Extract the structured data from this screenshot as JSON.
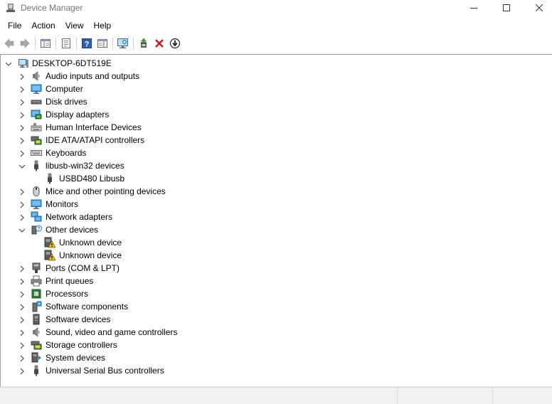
{
  "window": {
    "title": "Device Manager",
    "icon": "device-manager-icon",
    "controls": [
      "minimize-icon",
      "maximize-icon",
      "close-icon"
    ]
  },
  "menu": [
    "File",
    "Action",
    "View",
    "Help"
  ],
  "toolbar": [
    {
      "name": "back-button",
      "icon": "arrow-left-icon"
    },
    {
      "name": "forward-button",
      "icon": "arrow-right-icon"
    },
    {
      "name": "show-hide-console-tree-button",
      "icon": "console-tree-icon"
    },
    {
      "name": "properties-button",
      "icon": "properties-icon"
    },
    {
      "name": "help-button",
      "icon": "help-icon"
    },
    {
      "name": "show-action-pane-button",
      "icon": "action-pane-icon"
    },
    {
      "name": "scan-hardware-button",
      "icon": "monitor-scan-icon"
    },
    {
      "name": "update-driver-button",
      "icon": "update-driver-icon"
    },
    {
      "name": "uninstall-device-button",
      "icon": "red-x-icon"
    },
    {
      "name": "disable-device-button",
      "icon": "down-arrow-circle-icon"
    }
  ],
  "tree": {
    "root": {
      "label": "DESKTOP-6DT519E",
      "icon": "computer-icon",
      "expanded": true
    },
    "items": [
      {
        "label": "Audio inputs and outputs",
        "icon": "speaker-icon",
        "expanded": false,
        "children": []
      },
      {
        "label": "Computer",
        "icon": "monitor-icon",
        "expanded": false,
        "children": []
      },
      {
        "label": "Disk drives",
        "icon": "disk-drive-icon",
        "expanded": false,
        "children": []
      },
      {
        "label": "Display adapters",
        "icon": "display-adapter-icon",
        "expanded": false,
        "children": []
      },
      {
        "label": "Human Interface Devices",
        "icon": "hid-icon",
        "expanded": false,
        "children": []
      },
      {
        "label": "IDE ATA/ATAPI controllers",
        "icon": "ide-controller-icon",
        "expanded": false,
        "children": []
      },
      {
        "label": "Keyboards",
        "icon": "keyboard-icon",
        "expanded": false,
        "children": []
      },
      {
        "label": "libusb-win32 devices",
        "icon": "usb-plug-icon",
        "expanded": true,
        "children": [
          {
            "label": "USBD480 Libusb",
            "icon": "usb-plug-icon"
          }
        ]
      },
      {
        "label": "Mice and other pointing devices",
        "icon": "mouse-icon",
        "expanded": false,
        "children": []
      },
      {
        "label": "Monitors",
        "icon": "monitor-icon",
        "expanded": false,
        "children": []
      },
      {
        "label": "Network adapters",
        "icon": "network-adapter-icon",
        "expanded": false,
        "children": []
      },
      {
        "label": "Other devices",
        "icon": "unknown-device-icon",
        "expanded": true,
        "children": [
          {
            "label": "Unknown device",
            "icon": "warning-device-icon"
          },
          {
            "label": "Unknown device",
            "icon": "warning-device-icon"
          }
        ]
      },
      {
        "label": "Ports (COM & LPT)",
        "icon": "port-icon",
        "expanded": false,
        "children": []
      },
      {
        "label": "Print queues",
        "icon": "printer-icon",
        "expanded": false,
        "children": []
      },
      {
        "label": "Processors",
        "icon": "processor-icon",
        "expanded": false,
        "children": []
      },
      {
        "label": "Software components",
        "icon": "software-component-icon",
        "expanded": false,
        "children": []
      },
      {
        "label": "Software devices",
        "icon": "software-device-icon",
        "expanded": false,
        "children": []
      },
      {
        "label": "Sound, video and game controllers",
        "icon": "speaker-icon",
        "expanded": false,
        "children": []
      },
      {
        "label": "Storage controllers",
        "icon": "storage-controller-icon",
        "expanded": false,
        "children": []
      },
      {
        "label": "System devices",
        "icon": "system-device-icon",
        "expanded": false,
        "children": []
      },
      {
        "label": "Universal Serial Bus controllers",
        "icon": "usb-plug-icon",
        "expanded": false,
        "children": []
      }
    ]
  },
  "colors": {
    "accent_blue": "#2b78c8",
    "warning_yellow": "#f5c518",
    "delete_red": "#d11b1b",
    "update_green": "#2e9a3a"
  }
}
